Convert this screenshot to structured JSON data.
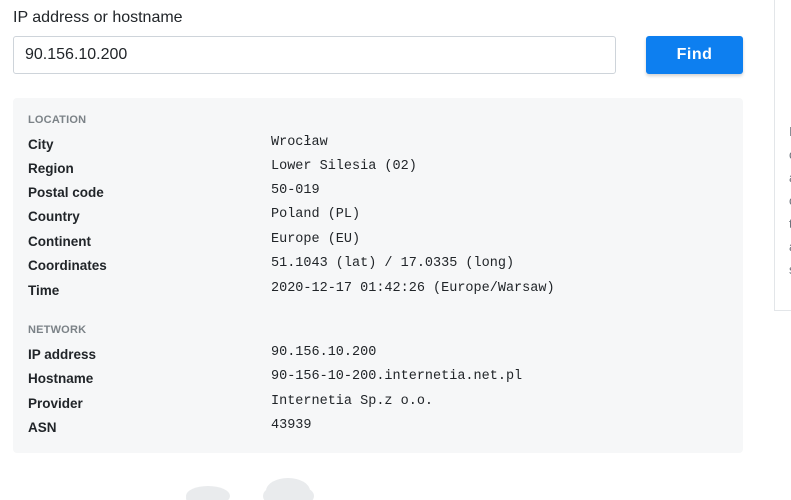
{
  "search": {
    "label": "IP address or hostname",
    "value": "90.156.10.200",
    "button_label": "Find"
  },
  "location": {
    "title": "LOCATION",
    "rows": [
      {
        "key": "City",
        "value": "Wrocław"
      },
      {
        "key": "Region",
        "value": "Lower Silesia (02)"
      },
      {
        "key": "Postal code",
        "value": "50-019"
      },
      {
        "key": "Country",
        "value": "Poland (PL)"
      },
      {
        "key": "Continent",
        "value": "Europe (EU)"
      },
      {
        "key": "Coordinates",
        "value": "51.1043 (lat) / 17.0335 (long)"
      },
      {
        "key": "Time",
        "value": "2020-12-17 01:42:26 (Europe/Warsaw)"
      }
    ]
  },
  "network": {
    "title": "NETWORK",
    "rows": [
      {
        "key": "IP address",
        "value": "90.156.10.200"
      },
      {
        "key": "Hostname",
        "value": "90-156-10-200.internetia.net.pl"
      },
      {
        "key": "Provider",
        "value": "Internetia Sp.z o.o."
      },
      {
        "key": "ASN",
        "value": "43939"
      }
    ]
  },
  "side_panel": {
    "glyphs": [
      "I",
      "c",
      "a",
      "c",
      "t",
      "a",
      "s"
    ]
  }
}
